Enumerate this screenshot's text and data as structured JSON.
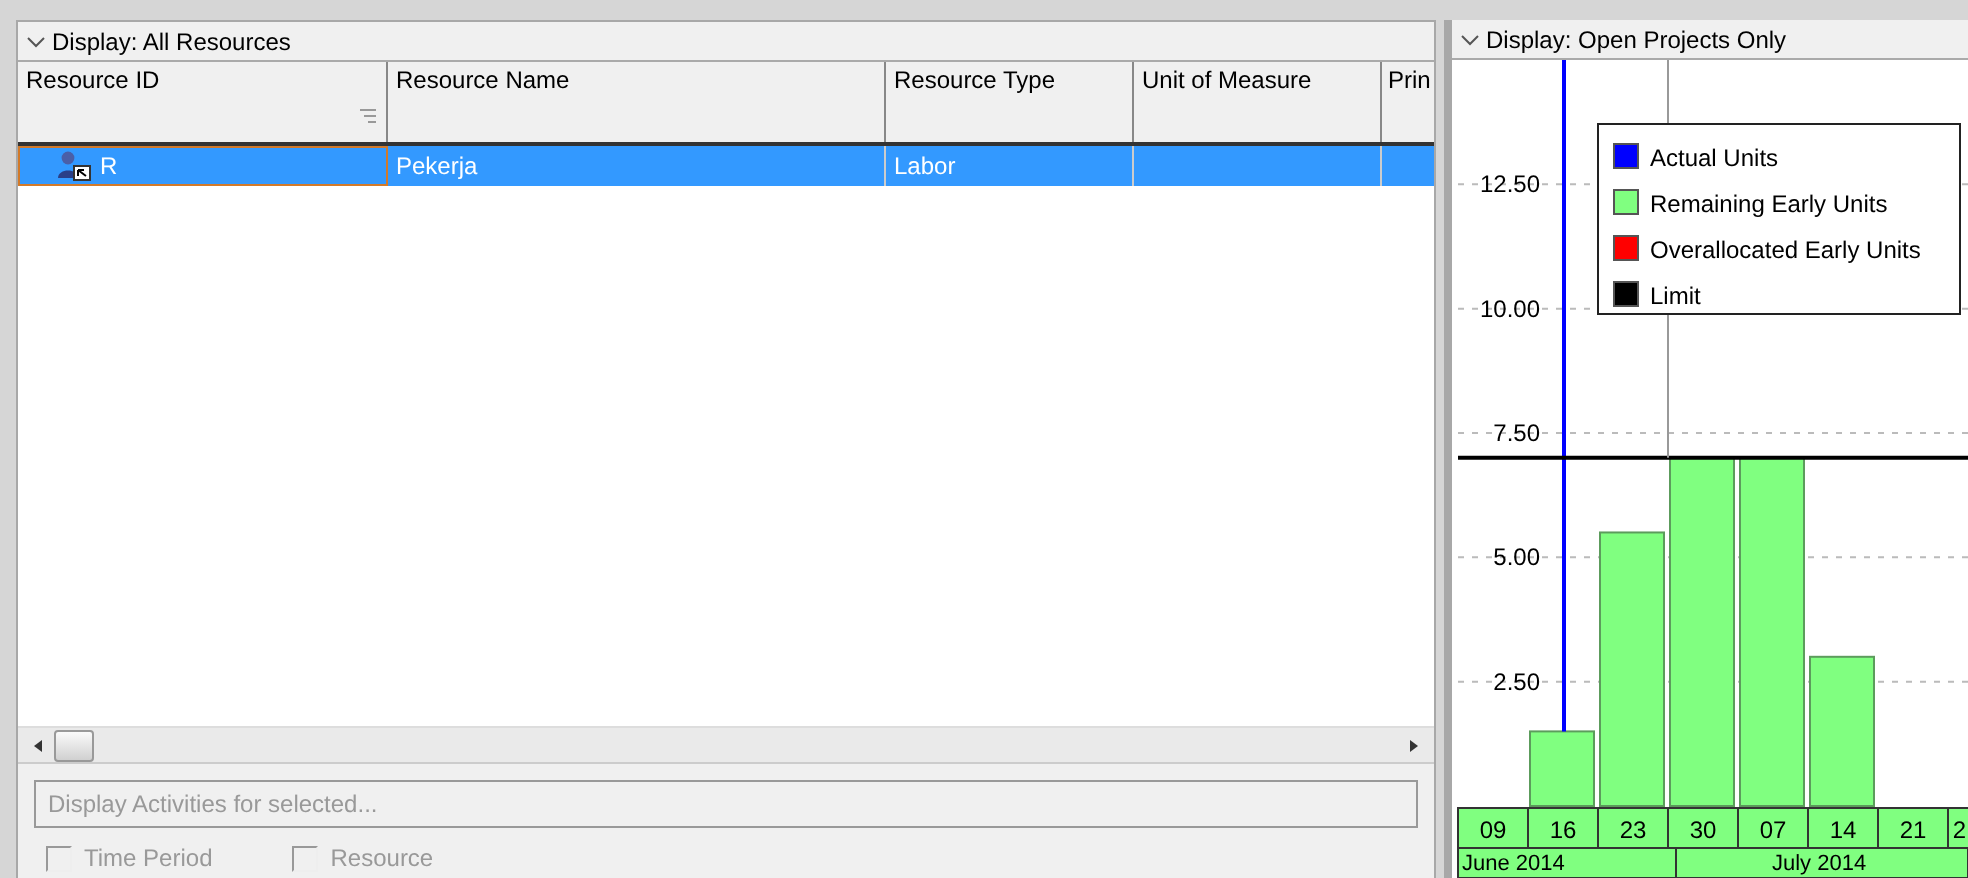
{
  "resources_panel": {
    "header": "Display: All Resources",
    "table": {
      "columns": [
        {
          "label": "Resource ID",
          "sortable": true
        },
        {
          "label": "Resource Name",
          "sortable": false
        },
        {
          "label": "Resource Type",
          "sortable": false
        },
        {
          "label": "Unit of Measure",
          "sortable": false
        },
        {
          "label": "Prin",
          "sortable": false
        }
      ],
      "rows": [
        {
          "selected": true,
          "cells": [
            "R",
            "Pekerja",
            "Labor",
            "",
            ""
          ]
        }
      ]
    },
    "activities_filter": {
      "label": "Display Activities for selected...",
      "disabled": true,
      "options": [
        {
          "label": "Time Period",
          "checked": false
        },
        {
          "label": "Resource",
          "checked": false
        }
      ]
    }
  },
  "usage_panel": {
    "header": "Display: Open Projects Only",
    "months": [
      "June 2014",
      "July 2014"
    ],
    "chart_data": {
      "type": "bar",
      "categories": [
        "09",
        "16",
        "23",
        "30",
        "07",
        "14",
        "21",
        "2"
      ],
      "series": [
        {
          "name": "Actual Units",
          "color": "#0000ff",
          "values": [
            null,
            null,
            null,
            null,
            null,
            null,
            null,
            null
          ]
        },
        {
          "name": "Remaining Early Units",
          "color": "#80ff80",
          "values": [
            0,
            1.5,
            5.5,
            7,
            7,
            3,
            0,
            null
          ]
        },
        {
          "name": "Overallocated Early Units",
          "color": "#ff0000",
          "values": [
            null,
            null,
            null,
            null,
            null,
            null,
            null,
            null
          ]
        }
      ],
      "legend": true,
      "ref_lines": [
        {
          "axis": "y",
          "value": 7,
          "label": "Limit",
          "color": "#000000"
        },
        {
          "axis": "x",
          "value": "30",
          "color": "#999999"
        }
      ],
      "grid": true,
      "ylim": [
        0,
        15
      ],
      "yticks": [
        {
          "value": 2.5,
          "label": "2.50"
        },
        {
          "value": 5,
          "label": "5.00"
        },
        {
          "value": 7.5,
          "label": "7.50"
        },
        {
          "value": 10,
          "label": "10.00"
        },
        {
          "value": 12.5,
          "label": "12.50"
        }
      ]
    }
  }
}
